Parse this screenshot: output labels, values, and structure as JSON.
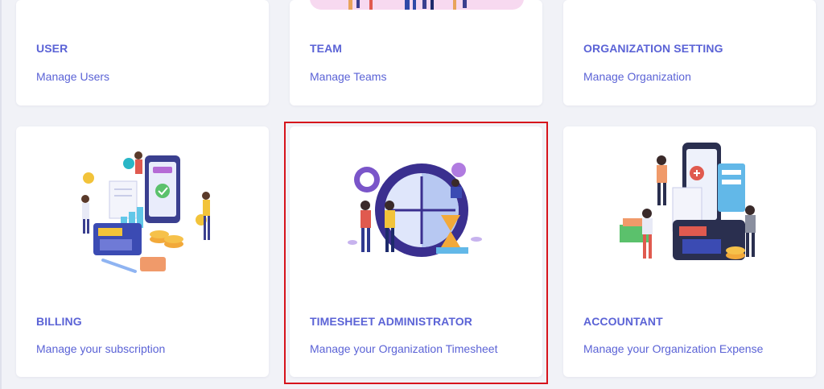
{
  "cards": [
    {
      "id": "user",
      "title": "USER",
      "subtitle": "Manage Users"
    },
    {
      "id": "team",
      "title": "TEAM",
      "subtitle": "Manage Teams"
    },
    {
      "id": "organization-setting",
      "title": "ORGANIZATION SETTING",
      "subtitle": "Manage Organization"
    },
    {
      "id": "billing",
      "title": "BILLING",
      "subtitle": "Manage your subscription",
      "illustration": "billing-illustration"
    },
    {
      "id": "timesheet-administrator",
      "title": "TIMESHEET ADMINISTRATOR",
      "subtitle": "Manage your Organization Timesheet",
      "illustration": "timesheet-illustration",
      "highlighted": true
    },
    {
      "id": "accountant",
      "title": "ACCOUNTANT",
      "subtitle": "Manage your Organization Expense",
      "illustration": "accountant-illustration"
    }
  ],
  "colors": {
    "accent": "#5b63d6",
    "background": "#f1f2f7",
    "card": "#ffffff",
    "highlight_border": "#d6141c"
  }
}
